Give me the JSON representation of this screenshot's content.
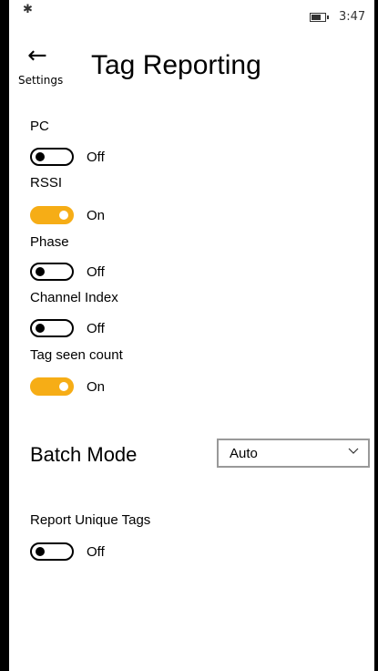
{
  "status_bar": {
    "bluetooth_icon": "bluetooth-icon",
    "battery_icon": "battery-icon",
    "time": "3:47"
  },
  "header": {
    "back_icon": "back-arrow-icon",
    "back_label": "Settings",
    "title": "Tag Reporting"
  },
  "settings": [
    {
      "label": "PC",
      "state": "Off",
      "on": false
    },
    {
      "label": "RSSI",
      "state": "On",
      "on": true
    },
    {
      "label": "Phase",
      "state": "Off",
      "on": false
    },
    {
      "label": "Channel Index",
      "state": "Off",
      "on": false
    },
    {
      "label": "Tag seen count",
      "state": "On",
      "on": true
    }
  ],
  "batch_mode": {
    "label": "Batch Mode",
    "selected": "Auto"
  },
  "report_unique_tags": {
    "label": "Report Unique Tags",
    "state": "Off",
    "on": false
  },
  "colors": {
    "accent": "#f6ad16",
    "frame": "#000000"
  }
}
